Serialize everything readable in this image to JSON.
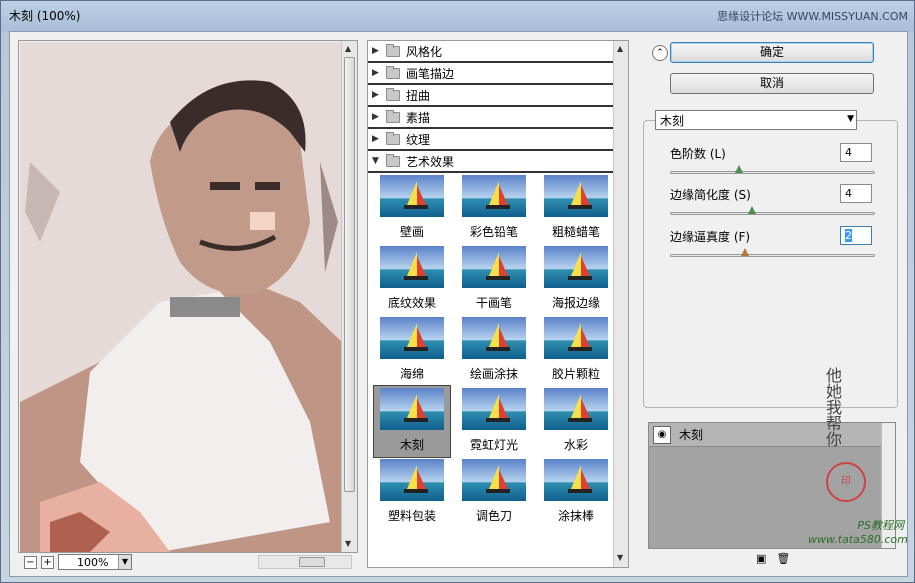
{
  "window": {
    "title": "木刻 (100%)",
    "top_watermark": "思缘设计论坛 WWW.MISSYUAN.COM"
  },
  "preview": {
    "zoom_out_label": "−",
    "zoom_in_label": "+",
    "zoom_value": "100%"
  },
  "filter_categories": [
    {
      "label": "风格化",
      "expanded": false
    },
    {
      "label": "画笔描边",
      "expanded": false
    },
    {
      "label": "扭曲",
      "expanded": false
    },
    {
      "label": "素描",
      "expanded": false
    },
    {
      "label": "纹理",
      "expanded": false
    },
    {
      "label": "艺术效果",
      "expanded": true
    }
  ],
  "artistic_filters": [
    {
      "label": "壁画"
    },
    {
      "label": "彩色铅笔"
    },
    {
      "label": "粗糙蜡笔"
    },
    {
      "label": "底纹效果"
    },
    {
      "label": "干画笔"
    },
    {
      "label": "海报边缘"
    },
    {
      "label": "海绵"
    },
    {
      "label": "绘画涂抹"
    },
    {
      "label": "胶片颗粒"
    },
    {
      "label": "木刻",
      "selected": true
    },
    {
      "label": "霓虹灯光"
    },
    {
      "label": "水彩"
    },
    {
      "label": "塑料包装"
    },
    {
      "label": "调色刀"
    },
    {
      "label": "涂抹棒"
    }
  ],
  "buttons": {
    "ok": "确定",
    "cancel": "取消"
  },
  "filter_select": {
    "value": "木刻"
  },
  "params": [
    {
      "label": "色阶数 (L)",
      "value": "4"
    },
    {
      "label": "边缘简化度 (S)",
      "value": "4"
    },
    {
      "label": "边缘逼真度 (F)",
      "value": "2"
    }
  ],
  "layers": [
    {
      "label": "木刻"
    }
  ],
  "watermark": {
    "site": "PS教程网",
    "url": "www.tata580.com",
    "signature": "他她我帮你"
  }
}
